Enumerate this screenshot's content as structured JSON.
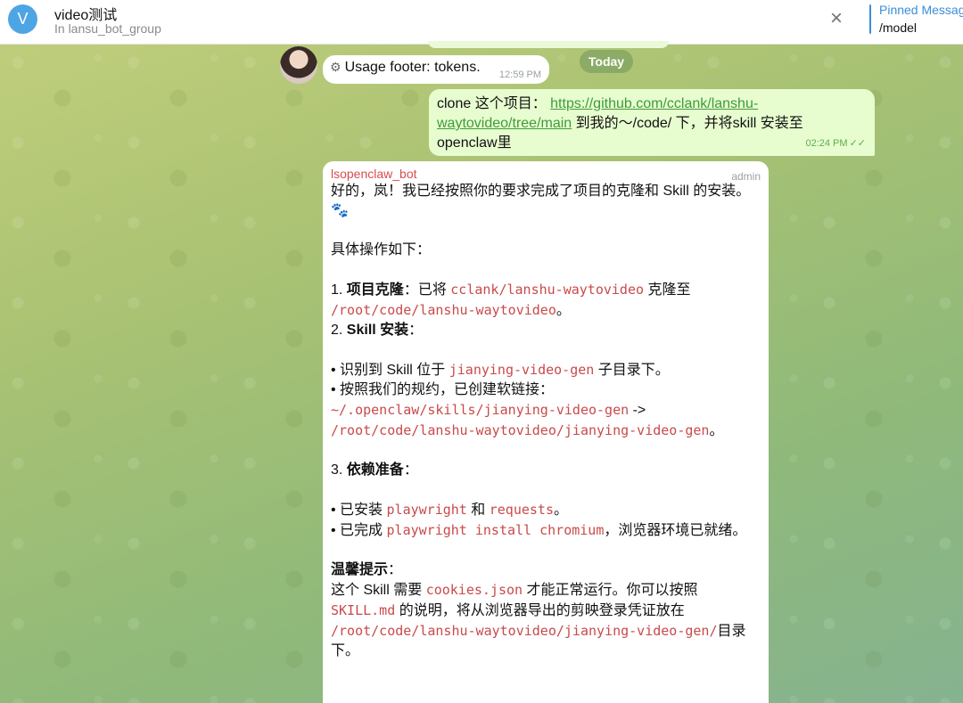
{
  "header": {
    "avatar_letter": "V",
    "title": "video测试",
    "subtitle": "In lansu_bot_group",
    "close_icon": "×",
    "pinned_title": "Pinned Messag",
    "pinned_text": "/model"
  },
  "colors": {
    "accent": "#3a8fd9",
    "sender": "#d84c4f",
    "code": "#c94a4a",
    "outgoing_bg": "#e7fdd0"
  },
  "messages": {
    "usage": {
      "icon": "gear-icon",
      "icon_glyph": "⚙",
      "text": "Usage footer: tokens.",
      "time": "12:59 PM"
    },
    "date_divider": "Today",
    "outgoing": {
      "prefix": "clone 这个项目：",
      "link": "https://github.com/cclank/lanshu-waytovideo/tree/main",
      "suffix": "到我的～/code/ 下，并将skill 安装至 openclaw里",
      "time": "02:24 PM",
      "checks": "✓✓"
    },
    "bot": {
      "sender": "lsopenclaw_bot",
      "role": "admin",
      "l1": "好的，岚！我已经按照你的要求完成了项目的克隆和 Skill 的安装。🐾",
      "l2": "具体操作如下：",
      "s1_num": "1.",
      "s1_title": "项目克隆",
      "s1_a": "：已将",
      "s1_code1": "cclank/lanshu-waytovideo",
      "s1_b": "克隆至",
      "s1_code2": "/root/code/lanshu-waytovideo",
      "s1_end": "。",
      "s2_num": "2.",
      "s2_title": "Skill 安装",
      "s2_colon": "：",
      "b1_a": "• 识别到 Skill 位于",
      "b1_code": "jianying-video-gen",
      "b1_b": "子目录下。",
      "b2_a": "• 按照我们的规约，已创建软链接：",
      "b2_code1": "~/.openclaw/skills/jianying-video-gen",
      "b2_arrow": "->",
      "b2_code2": "/root/code/lanshu-waytovideo/jianying-video-gen",
      "b2_end": "。",
      "s3_num": "3.",
      "s3_title": "依赖准备",
      "s3_colon": "：",
      "b3_a": "• 已安装",
      "b3_code1": "playwright",
      "b3_and": "和",
      "b3_code2": "requests",
      "b3_end": "。",
      "b4_a": "• 已完成",
      "b4_code": "playwright install chromium",
      "b4_b": "，浏览器环境已就绪。",
      "tip_title": "温馨提示",
      "tip_colon": "：",
      "tip_a": "这个 Skill 需要",
      "tip_code1": "cookies.json",
      "tip_b": "才能正常运行。你可以按照",
      "tip_code2": "SKILL.md",
      "tip_c": "的说明，将从浏览器导出的剪映登录凭证放在",
      "tip_code3": "/root/code/lanshu-waytovideo/jianying-video-gen/",
      "tip_d": "目录下。"
    }
  }
}
